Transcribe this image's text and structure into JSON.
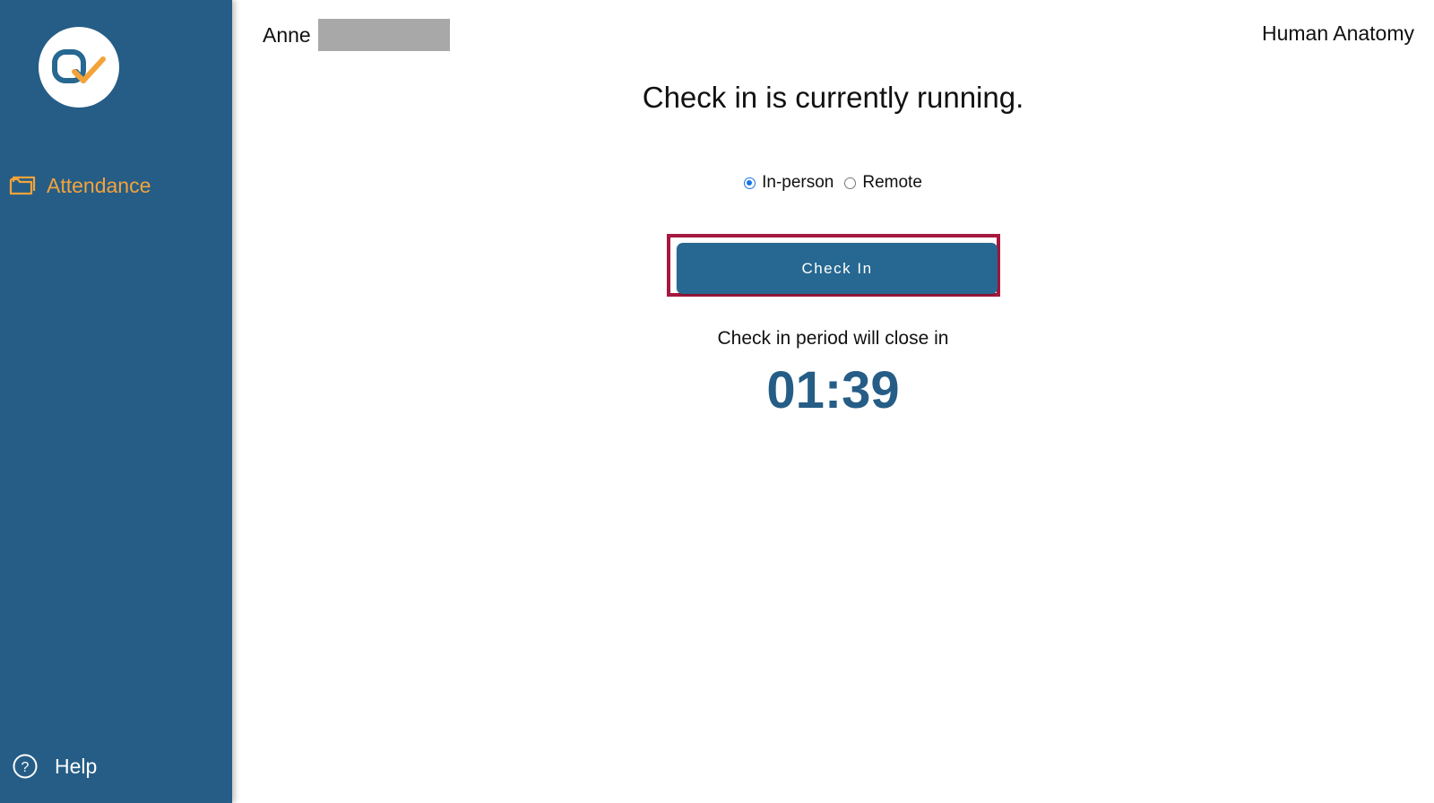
{
  "sidebar": {
    "logo_icon": "quiz-check-logo",
    "items": [
      {
        "label": "Attendance",
        "icon": "folder-icon",
        "color": "#f3a33a"
      }
    ],
    "help": {
      "label": "Help",
      "icon": "question-circle-icon"
    },
    "background": "#255d86"
  },
  "header": {
    "user_first_name": "Anne",
    "course_name": "Human Anatomy"
  },
  "main": {
    "headline": "Check in is currently running.",
    "mode_options": [
      {
        "label": "In-person",
        "selected": true
      },
      {
        "label": "Remote",
        "selected": false
      }
    ],
    "check_in_button": "Check In",
    "period_text": "Check in period will close in",
    "countdown": "01:39"
  },
  "colors": {
    "primary": "#266891",
    "accent": "#f3a33a",
    "highlight": "#a6183f"
  }
}
